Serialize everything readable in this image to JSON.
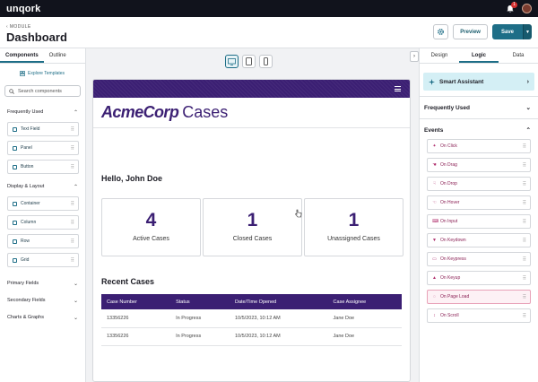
{
  "topbar": {
    "brand": "unqork",
    "notification_count": "1"
  },
  "header": {
    "module_label": "MODULE",
    "title": "Dashboard",
    "preview_label": "Preview",
    "save_label": "Save"
  },
  "left_panel": {
    "tabs": [
      {
        "label": "Components"
      },
      {
        "label": "Outline"
      }
    ],
    "explore_label": "Explore Templates",
    "search_placeholder": "Search components",
    "sections": {
      "frequently_used": {
        "label": "Frequently Used",
        "items": [
          {
            "label": "Text Field"
          },
          {
            "label": "Panel"
          },
          {
            "label": "Button"
          }
        ]
      },
      "display_layout": {
        "label": "Display & Layout",
        "items": [
          {
            "label": "Container"
          },
          {
            "label": "Column"
          },
          {
            "label": "Row"
          },
          {
            "label": "Grid"
          }
        ]
      },
      "primary_fields": {
        "label": "Primary Fields"
      },
      "secondary_fields": {
        "label": "Secondary Fields"
      },
      "charts_graphs": {
        "label": "Charts & Graphs"
      }
    }
  },
  "preview": {
    "logo_acme": "AcmeCorp",
    "logo_cases": "Cases",
    "greeting": "Hello, John Doe",
    "cards": [
      {
        "value": "4",
        "label": "Active Cases"
      },
      {
        "value": "1",
        "label": "Closed Cases"
      },
      {
        "value": "1",
        "label": "Unassigned Cases"
      }
    ],
    "recent_title": "Recent Cases",
    "table": {
      "headers": [
        "Case Number",
        "Status",
        "Date/Time Opened",
        "Case Assignee"
      ],
      "rows": [
        [
          "13356226",
          "In Progress",
          "10/5/2023, 10:12 AM",
          "Jane Doe"
        ],
        [
          "13356226",
          "In Progress",
          "10/5/2023, 10:12 AM",
          "Jane Doe"
        ]
      ]
    }
  },
  "right_panel": {
    "tabs": [
      {
        "label": "Design"
      },
      {
        "label": "Logic"
      },
      {
        "label": "Data"
      }
    ],
    "smart_assistant": "Smart Assistant",
    "frequently_used": "Frequently Used",
    "events_label": "Events",
    "events": [
      {
        "label": "On Click"
      },
      {
        "label": "On Drag"
      },
      {
        "label": "On Drop"
      },
      {
        "label": "On Hover"
      },
      {
        "label": "On Input"
      },
      {
        "label": "On Keydown"
      },
      {
        "label": "On Keypress"
      },
      {
        "label": "On Keyup"
      },
      {
        "label": "On Page Load"
      },
      {
        "label": "On Scroll"
      }
    ]
  },
  "colors": {
    "brand_purple": "#3b1f73",
    "teal_accent": "#1e6e87",
    "event_text": "#8a1f54"
  }
}
